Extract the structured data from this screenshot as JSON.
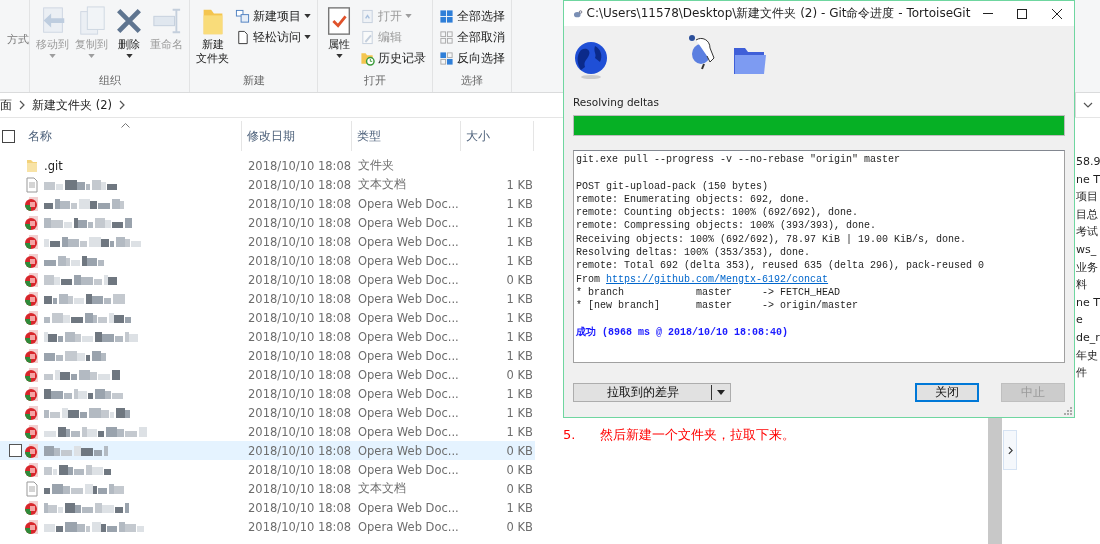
{
  "ribbon": {
    "cut_group": {
      "label": "方式"
    },
    "groups": [
      {
        "label": "组织",
        "items": [
          {
            "kind": "large",
            "label": "移动到",
            "disabled": true,
            "dropdown": true
          },
          {
            "kind": "large",
            "label": "复制到",
            "disabled": true,
            "dropdown": true
          },
          {
            "kind": "large",
            "label": "删除",
            "disabled": false,
            "dropdown": true
          },
          {
            "kind": "large",
            "label": "重命名",
            "disabled": true,
            "dropdown": false
          }
        ]
      },
      {
        "label": "新建",
        "items": [
          {
            "kind": "large",
            "lines": [
              "新建",
              "文件夹"
            ],
            "disabled": false,
            "dropdown": false
          },
          {
            "kind": "small",
            "label": "新建项目",
            "disabled": false,
            "dropdown": true
          },
          {
            "kind": "small",
            "label": "轻松访问",
            "disabled": false,
            "dropdown": true
          }
        ]
      },
      {
        "label": "打开",
        "items": [
          {
            "kind": "large",
            "label": "属性",
            "disabled": false,
            "dropdown": true
          },
          {
            "kind": "small",
            "label": "打开",
            "disabled": true,
            "dropdown": true
          },
          {
            "kind": "small",
            "label": "编辑",
            "disabled": true,
            "dropdown": false
          },
          {
            "kind": "small",
            "label": "历史记录",
            "disabled": false,
            "dropdown": false
          }
        ]
      },
      {
        "label": "选择",
        "items": [
          {
            "kind": "small",
            "label": "全部选择",
            "disabled": false,
            "dropdown": false
          },
          {
            "kind": "small",
            "label": "全部取消",
            "disabled": false,
            "dropdown": false
          },
          {
            "kind": "small",
            "label": "反向选择",
            "disabled": false,
            "dropdown": false
          }
        ]
      }
    ]
  },
  "address": {
    "crumbs": [
      {
        "label": "面"
      },
      {
        "label": "新建文件夹 (2)"
      }
    ]
  },
  "select_all": {
    "checked": false
  },
  "columns": [
    {
      "label": "名称",
      "sorted": true
    },
    {
      "label": "修改日期",
      "sorted": false
    },
    {
      "label": "类型",
      "sorted": false
    },
    {
      "label": "大小",
      "sorted": false
    }
  ],
  "rows": [
    {
      "kind": "folder",
      "name": ".git",
      "date": "2018/10/10 18:08",
      "type": "文件夹",
      "selected": false
    },
    {
      "kind": "text",
      "date": "2018/10/10 18:08",
      "type": "文本文档",
      "size": "1 KB",
      "selected": false
    },
    {
      "kind": "web",
      "date": "2018/10/10 18:08",
      "type": "Opera Web Doc...",
      "size": "1 KB",
      "selected": false
    },
    {
      "kind": "web",
      "date": "2018/10/10 18:08",
      "type": "Opera Web Doc...",
      "size": "1 KB",
      "selected": false
    },
    {
      "kind": "web",
      "date": "2018/10/10 18:08",
      "type": "Opera Web Doc...",
      "size": "1 KB",
      "selected": false
    },
    {
      "kind": "web",
      "date": "2018/10/10 18:08",
      "type": "Opera Web Doc...",
      "size": "1 KB",
      "selected": false
    },
    {
      "kind": "web",
      "date": "2018/10/10 18:08",
      "type": "Opera Web Doc...",
      "size": "0 KB",
      "selected": false
    },
    {
      "kind": "web",
      "date": "2018/10/10 18:08",
      "type": "Opera Web Doc...",
      "size": "1 KB",
      "selected": false
    },
    {
      "kind": "web",
      "date": "2018/10/10 18:08",
      "type": "Opera Web Doc...",
      "size": "1 KB",
      "selected": false
    },
    {
      "kind": "web",
      "date": "2018/10/10 18:08",
      "type": "Opera Web Doc...",
      "size": "1 KB",
      "selected": false
    },
    {
      "kind": "web",
      "date": "2018/10/10 18:08",
      "type": "Opera Web Doc...",
      "size": "1 KB",
      "selected": false
    },
    {
      "kind": "web",
      "date": "2018/10/10 18:08",
      "type": "Opera Web Doc...",
      "size": "0 KB",
      "selected": false
    },
    {
      "kind": "web",
      "date": "2018/10/10 18:08",
      "type": "Opera Web Doc...",
      "size": "1 KB",
      "selected": false
    },
    {
      "kind": "web",
      "date": "2018/10/10 18:08",
      "type": "Opera Web Doc...",
      "size": "1 KB",
      "selected": false
    },
    {
      "kind": "web",
      "date": "2018/10/10 18:08",
      "type": "Opera Web Doc...",
      "size": "1 KB",
      "selected": false
    },
    {
      "kind": "web",
      "date": "2018/10/10 18:08",
      "type": "Opera Web Doc...",
      "size": "0 KB",
      "selected": true
    },
    {
      "kind": "web",
      "date": "2018/10/10 18:08",
      "type": "Opera Web Doc...",
      "size": "0 KB",
      "selected": false
    },
    {
      "kind": "text",
      "date": "2018/10/10 18:08",
      "type": "文本文档",
      "size": "0 KB",
      "selected": false
    },
    {
      "kind": "web",
      "date": "2018/10/10 18:08",
      "type": "Opera Web Doc...",
      "size": "1 KB",
      "selected": false
    },
    {
      "kind": "web",
      "date": "2018/10/10 18:08",
      "type": "Opera Web Doc...",
      "size": "0 KB",
      "selected": false
    }
  ],
  "dialog": {
    "title": "C:\\Users\\11578\\Desktop\\新建文件夹 (2) - Git命令进度 - TortoiseGit",
    "status": "Resolving deltas",
    "progress": {
      "level": 1
    },
    "log": [
      {
        "kind": "plain",
        "text": "git.exe pull --progress -v --no-rebase \"origin\" master"
      },
      {
        "kind": "gap"
      },
      {
        "kind": "plain",
        "text": "POST git-upload-pack (150 bytes)"
      },
      {
        "kind": "plain",
        "text": "remote: Enumerating objects: 692, done."
      },
      {
        "kind": "plain",
        "text": "remote: Counting objects: 100% (692/692), done."
      },
      {
        "kind": "plain",
        "text": "remote: Compressing objects: 100% (393/393), done."
      },
      {
        "kind": "plain",
        "text": "Receiving objects: 100% (692/692), 78.97 KiB | 19.00 KiB/s, done."
      },
      {
        "kind": "plain",
        "text": "Resolving deltas: 100% (353/353), done."
      },
      {
        "kind": "plain",
        "text": "remote: Total 692 (delta 353), reused 635 (delta 296), pack-reused 0"
      },
      {
        "kind": "link",
        "prefix": "From",
        "url": "https://github.com/Mengtx-6192/concat"
      },
      {
        "kind": "plain",
        "text": "* branch            master     -> FETCH_HEAD"
      },
      {
        "kind": "plain",
        "text": "* [new branch]      master     -> origin/master"
      },
      {
        "kind": "gap"
      },
      {
        "kind": "success",
        "text": "成功 (8968 ms @ 2018/10/10 18:08:40)"
      }
    ],
    "buttons": [
      {
        "kind": "split",
        "label": "拉取到的差异",
        "default": false,
        "disabled": false
      },
      {
        "kind": "push",
        "label": "关闭",
        "default": true,
        "disabled": false
      },
      {
        "kind": "push",
        "label": "中止",
        "default": false,
        "disabled": true
      }
    ]
  },
  "note": {
    "number": "5.",
    "text": "然后新建一个文件夹，拉取下来。"
  },
  "side_text": [
    "58.9",
    "ne T",
    "项目",
    "目总",
    "考试",
    "ws_",
    "业务",
    "料",
    "ne T",
    "e",
    "de_r",
    "年史",
    "件"
  ]
}
